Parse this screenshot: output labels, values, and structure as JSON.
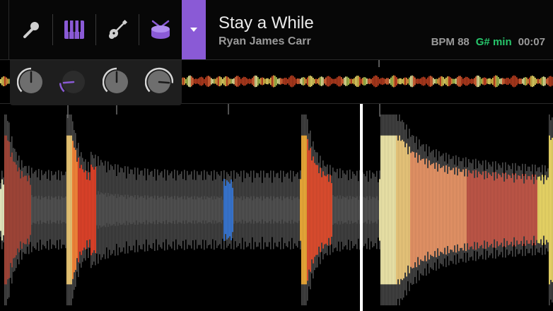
{
  "track": {
    "title": "Stay a While",
    "artist": "Ryan James Carr",
    "bpm": "BPM 88",
    "key": "G# min",
    "time": "00:07"
  },
  "stems": [
    {
      "name": "vocals",
      "icon": "microphone-icon",
      "active": false
    },
    {
      "name": "keys",
      "icon": "piano-icon",
      "active": true
    },
    {
      "name": "guitar",
      "icon": "guitar-icon",
      "active": false
    },
    {
      "name": "drums",
      "icon": "drum-icon",
      "active": true
    }
  ],
  "knobs": [
    {
      "name": "vocals",
      "level": 0.5,
      "highlighted": false
    },
    {
      "name": "keys",
      "level": 0.15,
      "highlighted": true
    },
    {
      "name": "guitar",
      "level": 0.5,
      "highlighted": false
    },
    {
      "name": "drums",
      "level": 0.85,
      "highlighted": false
    }
  ],
  "colors": {
    "accent": "#8a5ad6",
    "key_color": "#27c56b",
    "panel": "#1e1e1e",
    "header": "#070707"
  }
}
